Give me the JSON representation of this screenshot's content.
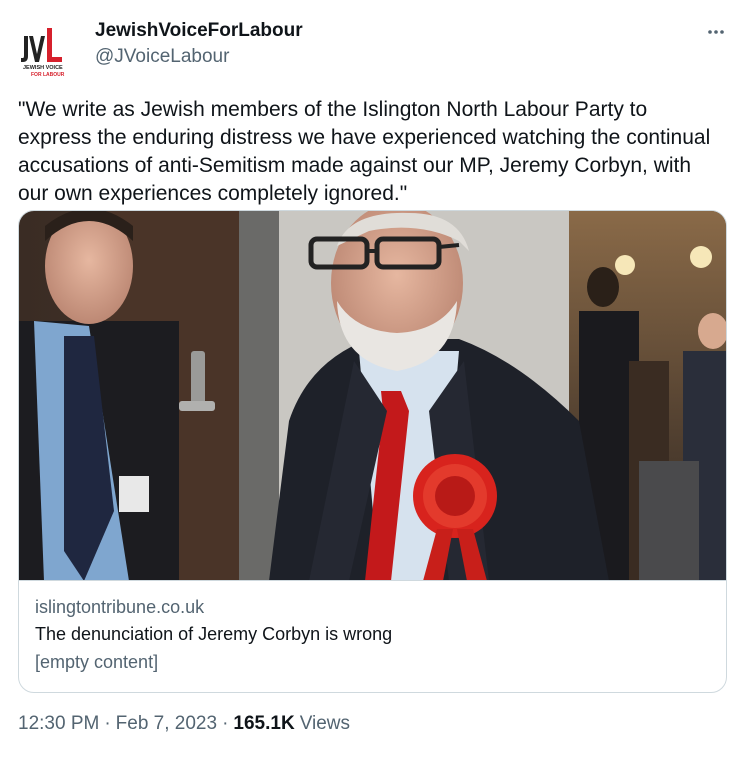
{
  "author": {
    "display_name": "JewishVoiceForLabour",
    "handle": "@JVoiceLabour",
    "avatar_logo_text": "JVL",
    "avatar_sub_text_1": "JEWISH VOICE",
    "avatar_sub_text_2": "FOR LABOUR"
  },
  "tweet": {
    "text": "\"We write as Jewish members of the Islington North Labour Party to express the enduring distress we have experienced watching the continual accusations of anti-Semitism made against our MP, Jeremy Corbyn, with our own experiences completely ignored.\""
  },
  "card": {
    "domain": "islingtontribune.co.uk",
    "title": "The denunciation of Jeremy Corbyn is wrong",
    "description": "[empty content]"
  },
  "meta": {
    "time": "12:30 PM",
    "separator": "·",
    "date": "Feb 7, 2023",
    "views_count": "165.1K",
    "views_label": "Views"
  },
  "icons": {
    "more": "more-horizontal-icon"
  },
  "colors": {
    "text_primary": "#0f1419",
    "text_secondary": "#536471",
    "border": "#cfd9de",
    "logo_red": "#d6202c",
    "rosette_red": "#d8231d"
  }
}
